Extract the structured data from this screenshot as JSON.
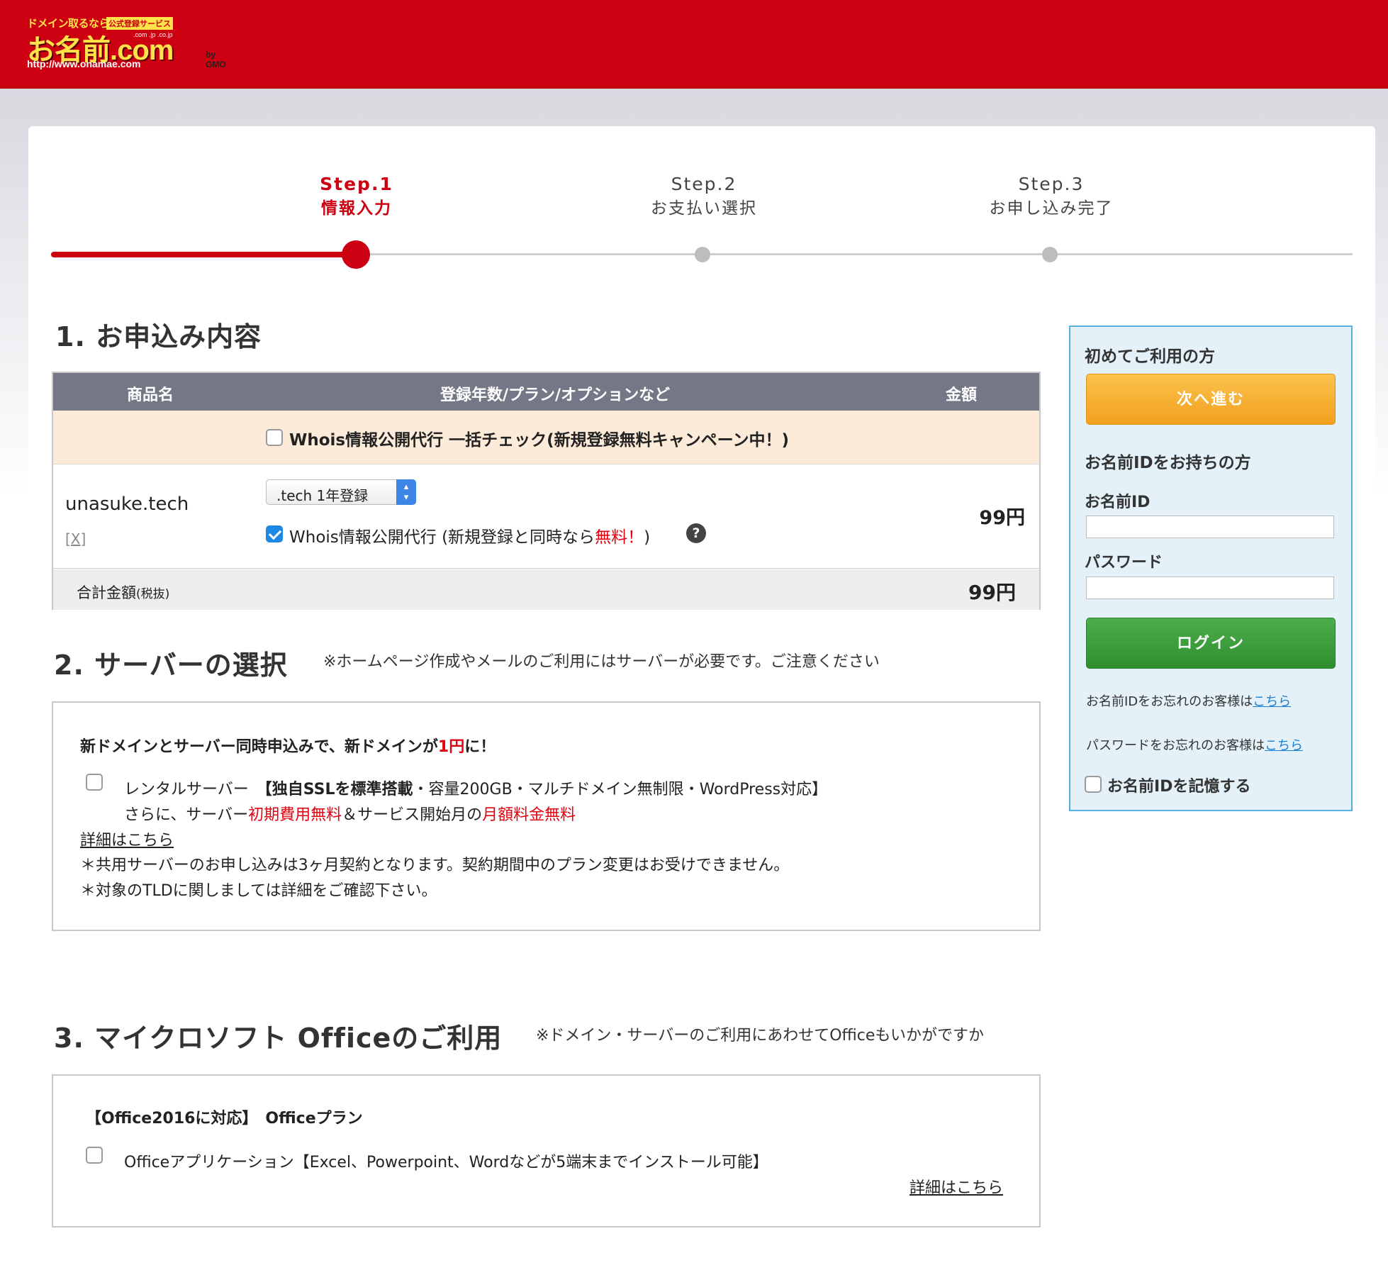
{
  "header": {
    "logo_tagline": "ドメイン取るなら",
    "logo_badge": "公式登録サービス",
    "logo_brand": "お名前.com",
    "logo_tlds": ".com .jp .co.jp",
    "logo_by": "by GMO",
    "logo_url": "http://www.onamae.com"
  },
  "steps": [
    {
      "num": "Step.1",
      "label": "情報入力",
      "active": true
    },
    {
      "num": "Step.2",
      "label": "お支払い選択",
      "active": false
    },
    {
      "num": "Step.3",
      "label": "お申し込み完了",
      "active": false
    }
  ],
  "section1": {
    "title": "1. お申込み内容",
    "table": {
      "headers": [
        "商品名",
        "登録年数/プラン/オプションなど",
        "金額"
      ],
      "bulk_option": "Whois情報公開代行 一括チェック(新規登録無料キャンペーン中！)",
      "bulk_checked": false,
      "row": {
        "domain": "unasuke.tech",
        "remove": "[X]",
        "plan": ".tech 1年登録",
        "whois_text": "Whois情報公開代行 (新規登録と同時なら",
        "whois_free": "無料！",
        "whois_close": ")",
        "whois_checked": true,
        "help": "?",
        "price": "99円"
      },
      "total_label": "合計金額",
      "total_note": "(税抜)",
      "total_value": "99円"
    }
  },
  "section2": {
    "title": "2. サーバーの選択",
    "note": "※ホームページ作成やメールのご利用にはサーバーが必要です。ご注意ください",
    "headline_a": "新ドメインとサーバー同時申込みで、新ドメインが",
    "headline_b": "1円",
    "headline_c": "に！",
    "option_a": "レンタルサーバー",
    "option_b": "【独自SSLを標準搭載",
    "option_c": "・容量200GB・マルチドメイン無制限・WordPress対応】",
    "line2_a": "さらに、サーバー",
    "line2_b": "初期費用無料",
    "line2_c": "＆サービス開始月の",
    "line2_d": "月額料金無料",
    "details": "詳細はこちら",
    "note1": "＊共用サーバーのお申し込みは3ヶ月契約となります。契約期間中のプラン変更はお受けできません。",
    "note2": "＊対象のTLDに関しましては詳細をご確認下さい。"
  },
  "section3": {
    "title": "3. マイクロソフト Officeのご利用",
    "note": "※ドメイン・サーバーのご利用にあわせてOfficeもいかがですか",
    "headline": "【Office2016に対応】　Officeプラン",
    "option": "Officeアプリケーション【Excel、Powerpoint、Wordなどが5端末までインストール可能】",
    "details": "詳細はこちら"
  },
  "sidebar": {
    "new_heading": "初めてご利用の方",
    "next_button": "次へ進む",
    "member_heading": "お名前IDをお持ちの方",
    "id_label": "お名前ID",
    "id_value": "",
    "password_label": "パスワード",
    "password_value": "",
    "login_button": "ログイン",
    "forgot_id_text": "お名前IDをお忘れのお客様は",
    "forgot_id_link": "こちら",
    "forgot_pw_text": "パスワードをお忘れのお客様は",
    "forgot_pw_link": "こちら",
    "remember_label": "お名前IDを記憶する",
    "remember_checked": false
  },
  "colors": {
    "brand_red": "#cc0011",
    "table_header": "#737786",
    "accent_blue": "#57b0e0",
    "next_orange": "#f2a01e",
    "login_green": "#2f8f2f"
  }
}
